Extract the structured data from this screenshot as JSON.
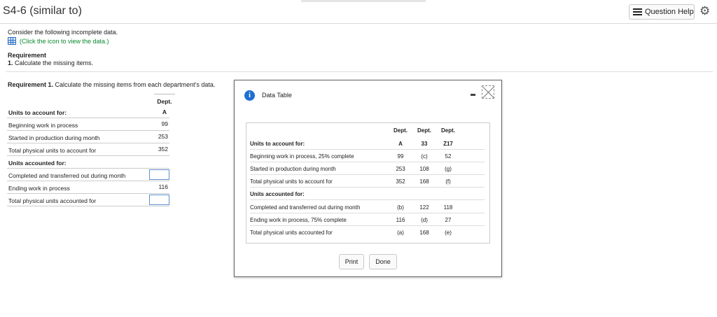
{
  "header": {
    "title": "S4-6 (similar to)",
    "help_label": "Question Help",
    "help_icon": "list-icon",
    "settings_icon": "gear-icon"
  },
  "question": {
    "intro": "Consider the following incomplete data.",
    "data_link": "(Click the icon to view the data.)",
    "requirement_heading": "Requirement",
    "requirement_num": "1.",
    "requirement_text": "Calculate the missing items."
  },
  "requirement1": {
    "bold": "Requirement 1.",
    "text": "Calculate the missing items from each department's data."
  },
  "work_table": {
    "col_header": "Dept.",
    "col_sub": "A",
    "rows": [
      {
        "label": "Units to account for:",
        "value": ""
      },
      {
        "label": "Beginning work in process",
        "value": "99"
      },
      {
        "label": "Started in production during month",
        "value": "253"
      },
      {
        "label": "Total physical units to account for",
        "value": "352"
      },
      {
        "label": "Units accounted for:",
        "value": ""
      },
      {
        "label": "Completed and transferred out during month",
        "value": ""
      },
      {
        "label": "Ending work in process",
        "value": "116"
      },
      {
        "label": "Total physical units accounted for",
        "value": ""
      }
    ]
  },
  "modal": {
    "title": "Data Table",
    "info_icon": "i",
    "headers": [
      "Dept.",
      "Dept.",
      "Dept."
    ],
    "subheaders": [
      "A",
      "33",
      "Z17"
    ],
    "rows": [
      {
        "label": "Units to account for:",
        "a": "",
        "b": "",
        "z": ""
      },
      {
        "label": "Beginning work in process, 25% complete",
        "a": "99",
        "b": "(c)",
        "z": "52"
      },
      {
        "label": "Started in production during month",
        "a": "253",
        "b": "108",
        "z": "(g)"
      },
      {
        "label": "Total physical units to account for",
        "a": "352",
        "b": "168",
        "z": "(f)"
      },
      {
        "label": "Units accounted for:",
        "a": "",
        "b": "",
        "z": ""
      },
      {
        "label": "Completed and transferred out during month",
        "a": "(b)",
        "b": "122",
        "z": "118"
      },
      {
        "label": "Ending work in process, 75% complete",
        "a": "116",
        "b": "(d)",
        "z": "27"
      },
      {
        "label": "Total physical units accounted for",
        "a": "(a)",
        "b": "168",
        "z": "(e)"
      }
    ],
    "print_label": "Print",
    "done_label": "Done"
  }
}
